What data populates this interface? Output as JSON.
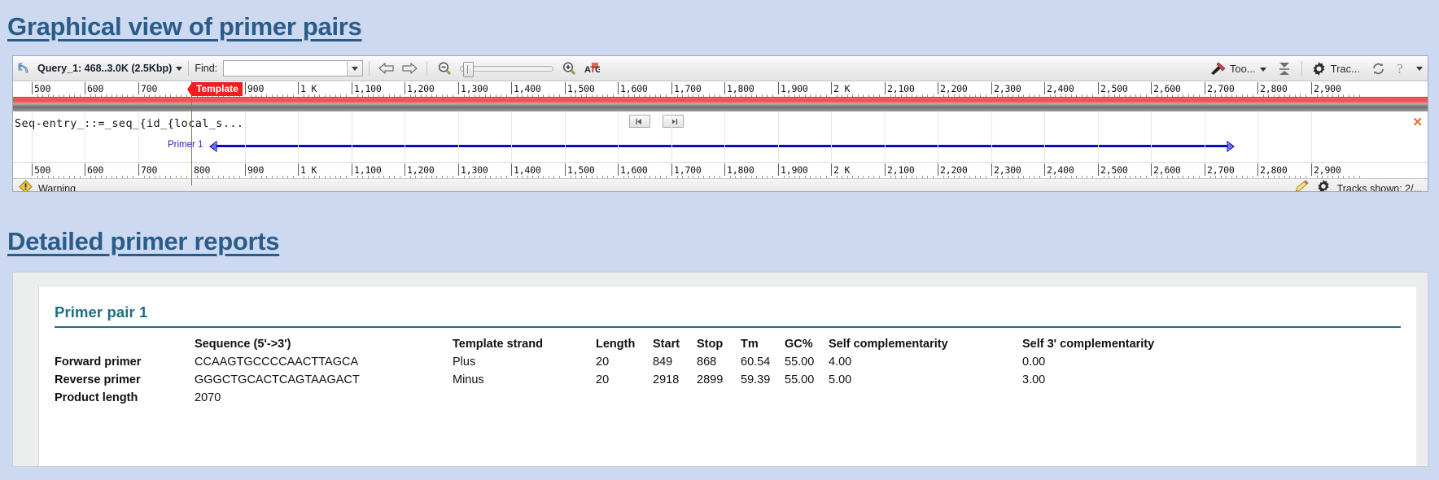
{
  "headings": {
    "graphical": "Graphical view of primer pairs",
    "detailed": "Detailed primer reports"
  },
  "viewer": {
    "toolbar": {
      "back_icon": "undo-arrow-icon",
      "query_label": "Query_1: 468..3.0K (2.5Kbp)",
      "find_label": "Find:",
      "find_value": "",
      "find_placeholder": "",
      "prev_icon": "arrow-left-icon",
      "next_icon": "arrow-right-icon",
      "zoom_out_icon": "zoom-out-icon",
      "zoom_in_icon": "zoom-in-icon",
      "sequence_icon": "atg-sequence-icon",
      "tools_label": "Too...",
      "tools_icon": "hammer-wrench-icon",
      "collapse_icon": "collapse-tracks-icon",
      "tracks_label": "Trac...",
      "tracks_icon": "gear-icon",
      "reload_icon": "reload-icon",
      "help_icon": "help-question-icon"
    },
    "ruler": {
      "ticks": [
        {
          "label": "500",
          "pos": 23
        },
        {
          "label": "600",
          "pos": 88
        },
        {
          "label": "700",
          "pos": 154
        },
        {
          "label": "800",
          "pos": 219
        },
        {
          "label": "900",
          "pos": 285
        },
        {
          "label": "1 K",
          "pos": 350
        },
        {
          "label": "1,100",
          "pos": 416
        },
        {
          "label": "1,200",
          "pos": 481
        },
        {
          "label": "1,300",
          "pos": 547
        },
        {
          "label": "1,400",
          "pos": 612
        },
        {
          "label": "1,500",
          "pos": 678
        },
        {
          "label": "1,600",
          "pos": 743
        },
        {
          "label": "1,700",
          "pos": 809
        },
        {
          "label": "1,800",
          "pos": 874
        },
        {
          "label": "1,900",
          "pos": 940
        },
        {
          "label": "2 K",
          "pos": 1005
        },
        {
          "label": "2,100",
          "pos": 1071
        },
        {
          "label": "2,200",
          "pos": 1136
        },
        {
          "label": "2,300",
          "pos": 1202
        },
        {
          "label": "2,400",
          "pos": 1267
        },
        {
          "label": "2,500",
          "pos": 1333
        },
        {
          "label": "2,600",
          "pos": 1398
        },
        {
          "label": "2,700",
          "pos": 1464
        },
        {
          "label": "2,800",
          "pos": 1529
        },
        {
          "label": "2,900",
          "pos": 1595
        }
      ]
    },
    "sequence_track": {
      "title": "Seq-entry_::=_seq_{id_{local_s...",
      "prev_page_icon": "page-prev-icon",
      "next_page_icon": "page-next-icon",
      "close_icon": "close-track-icon"
    },
    "template_flag": "Template",
    "primer": {
      "label": "Primer 1",
      "start_arrow_icon": "primer-forward-arrow-icon",
      "end_arrow_icon": "primer-reverse-arrow-icon"
    },
    "status": {
      "warning_icon": "warning-icon",
      "warning_label": "Warning",
      "pencil_icon": "pencil-edit-icon",
      "gear_icon": "gear-icon",
      "tracks_shown": "Tracks shown: 2/..."
    }
  },
  "report": {
    "pair_title": "Primer pair 1",
    "columns": {
      "sequence": "Sequence (5'->3')",
      "strand": "Template strand",
      "length": "Length",
      "start": "Start",
      "stop": "Stop",
      "tm": "Tm",
      "gc": "GC%",
      "self_comp": "Self complementarity",
      "self3_comp": "Self 3' complementarity"
    },
    "rows": [
      {
        "label": "Forward primer",
        "sequence": "CCAAGTGCCCCAACTTAGCA",
        "strand": "Plus",
        "length": "20",
        "start": "849",
        "stop": "868",
        "tm": "60.54",
        "gc": "55.00",
        "self_comp": "4.00",
        "self3_comp": "0.00"
      },
      {
        "label": "Reverse primer",
        "sequence": "GGGCTGCACTCAGTAAGACT",
        "strand": "Minus",
        "length": "20",
        "start": "2918",
        "stop": "2899",
        "tm": "59.39",
        "gc": "55.00",
        "self_comp": "5.00",
        "self3_comp": "3.00"
      }
    ],
    "product_label": "Product length",
    "product_value": "2070"
  },
  "colors": {
    "heading": "#2a5c8a",
    "page_bg": "#ccd9f0",
    "teal": "#1f6f80",
    "primer_blue": "#0a0ac8",
    "template_red": "#f01e1e"
  }
}
